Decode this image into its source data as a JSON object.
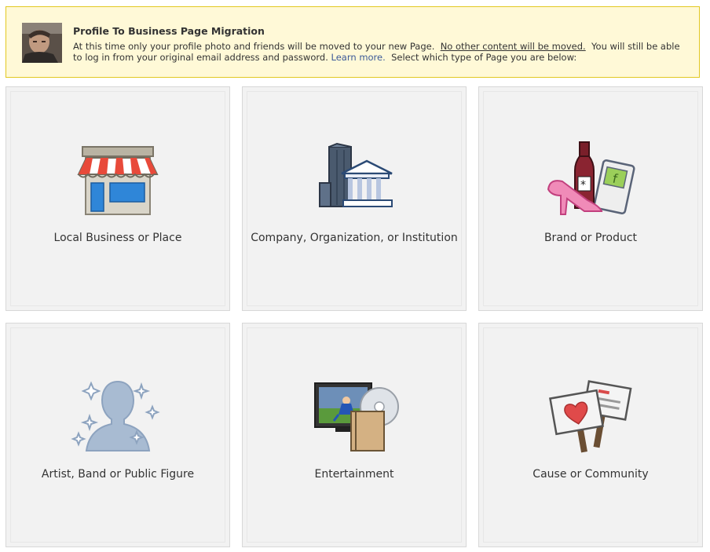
{
  "notice": {
    "title": "Profile To Business Page Migration",
    "text_1": "At this time only your profile photo and friends will be moved to your new Page.",
    "underline": "No other content will be moved.",
    "text_2": "You will still be able to log in from your original email address and password.",
    "link": "Learn more.",
    "text_3": "Select which type of Page you are below:"
  },
  "tiles": [
    {
      "label": "Local Business or Place",
      "icon": "storefront-icon"
    },
    {
      "label": "Company, Organization, or Institution",
      "icon": "buildings-icon"
    },
    {
      "label": "Brand or Product",
      "icon": "products-icon"
    },
    {
      "label": "Artist, Band or Public Figure",
      "icon": "silhouette-icon"
    },
    {
      "label": "Entertainment",
      "icon": "media-icon"
    },
    {
      "label": "Cause or Community",
      "icon": "signs-icon"
    }
  ]
}
